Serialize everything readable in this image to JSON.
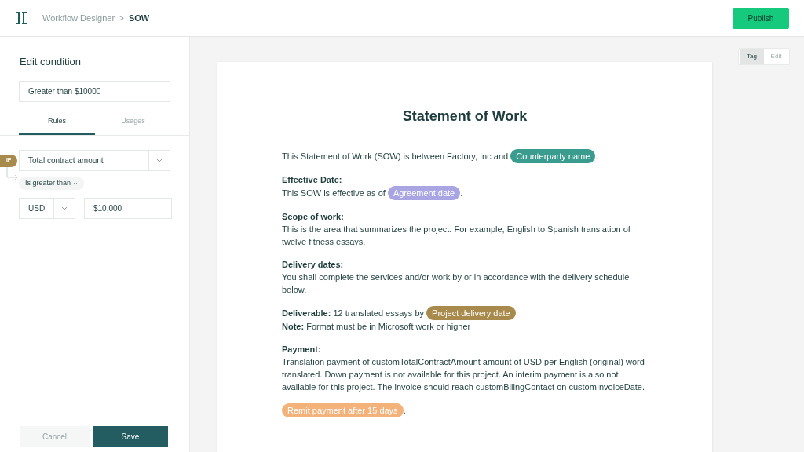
{
  "header": {
    "breadcrumb": [
      {
        "label": "Workflow Designer",
        "current": false
      },
      {
        "label": "SOW",
        "current": true
      }
    ],
    "separator": ">",
    "publish_button": "Publish"
  },
  "panel": {
    "title": "Edit condition",
    "name_value": "Greater than $10000",
    "tabs": [
      {
        "label": "Rules",
        "selected": true
      },
      {
        "label": "Usages",
        "selected": false
      }
    ],
    "rule": {
      "badge": "IF",
      "field": "Total contract amount",
      "operator": "Is greater than",
      "currency": "USD",
      "amount": "$10,000"
    },
    "buttons": {
      "cancel": "Cancel",
      "save": "Save"
    }
  },
  "mode_toggle": [
    {
      "label": "Tag",
      "selected": true
    },
    {
      "label": "Edit",
      "selected": false
    }
  ],
  "document": {
    "title": "Statement of Work",
    "paragraphs": [
      {
        "lines": [
          [
            {
              "kind": "text",
              "text": "This Statement of Work (SOW) is between Factory, Inc and "
            },
            {
              "kind": "tag",
              "text": "Counterparty name",
              "color": "#3a9b8f"
            },
            {
              "kind": "text",
              "text": "."
            }
          ]
        ]
      },
      {
        "heading": "Effective Date:",
        "lines": [
          [
            {
              "kind": "text",
              "text": "This SOW is effective as of "
            },
            {
              "kind": "tag",
              "text": "Agreement date",
              "color": "#a9a4e2"
            },
            {
              "kind": "text",
              "text": "."
            }
          ]
        ]
      },
      {
        "heading": "Scope of work:",
        "lines": [
          [
            {
              "kind": "text",
              "text": "This is the area that summarizes the project. For example, English to Spanish translation of twelve fitness essays."
            }
          ]
        ]
      },
      {
        "heading": "Delivery dates:",
        "lines": [
          [
            {
              "kind": "text",
              "text": "You shall complete the services and/or work by or in accordance with the delivery schedule below."
            }
          ]
        ]
      },
      {
        "lines": [
          [
            {
              "kind": "text",
              "text": "**Deliverable:** 12 translated essays by "
            },
            {
              "kind": "tag",
              "text": "Project delivery date",
              "color": "#a88b4c"
            }
          ],
          [
            {
              "kind": "text",
              "text": "**Note:** Format must be in Microsoft work or higher"
            }
          ]
        ]
      },
      {
        "heading": "Payment:",
        "lines": [
          [
            {
              "kind": "text",
              "text": "Translation payment of customTotalContractAmount amount of USD per English (original) word translated. Down payment is not available for this project. An interim payment is also not available for this project. The invoice should reach customBilingContact on customInvoiceDate."
            }
          ]
        ]
      },
      {
        "lines": [
          [
            {
              "kind": "tag",
              "text": "Remit payment after 15 days",
              "color": "#f2b27a"
            },
            {
              "kind": "text",
              "text": "."
            }
          ]
        ]
      }
    ]
  }
}
